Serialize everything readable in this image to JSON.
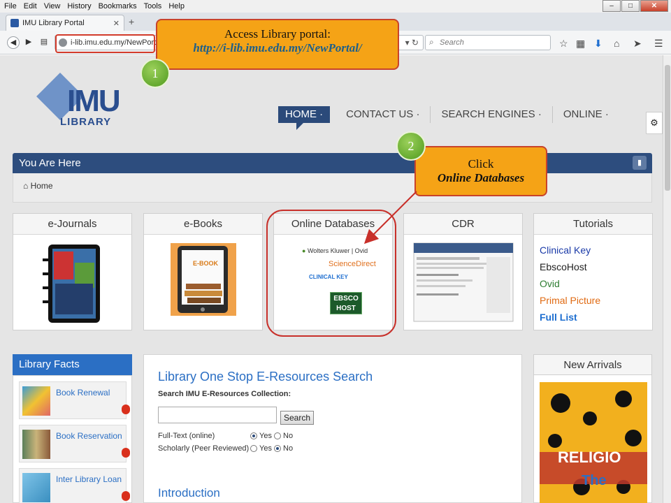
{
  "browser": {
    "menus": [
      "File",
      "Edit",
      "View",
      "History",
      "Bookmarks",
      "Tools",
      "Help"
    ],
    "tab_title": "IMU Library Portal",
    "url": "i-lib.imu.edu.my/NewPortal/",
    "search_placeholder": "Search",
    "window_controls": {
      "minimize": "–",
      "maximize": "□",
      "close": "✕"
    }
  },
  "header": {
    "logo_text": "IMU",
    "logo_subtext": "LIBRARY",
    "nav": [
      "HOME ·",
      "CONTACT US ·",
      "SEARCH ENGINES ·",
      "ONLINE ·"
    ]
  },
  "breadcrumb": {
    "heading": "You Are Here",
    "home": "Home"
  },
  "cards": [
    {
      "title": "e-Journals"
    },
    {
      "title": "e-Books",
      "cover_text": "E-BOOK"
    },
    {
      "title": "Online Databases",
      "logos": [
        "Wolters Kluwer",
        "Ovid",
        "ScienceDirect",
        "CLINICAL KEY",
        "EBSCO HOST"
      ]
    },
    {
      "title": "CDR"
    },
    {
      "title": "Tutorials"
    }
  ],
  "tutorials": {
    "links": [
      {
        "label": "Clinical Key",
        "color": "#1a3aa8"
      },
      {
        "label": "EbscoHost",
        "color": "#222222"
      },
      {
        "label": "Ovid",
        "color": "#2e7d32"
      },
      {
        "label": "Primal Picture",
        "color": "#e06a12"
      },
      {
        "label": "Full List",
        "color": "#1f6fd0"
      }
    ]
  },
  "library_facts": {
    "heading": "Library Facts",
    "items": [
      "Book Renewal",
      "Book Reservation",
      "Inter Library Loan"
    ]
  },
  "search": {
    "heading": "Library One Stop E-Resources Search",
    "subheading": "Search IMU E-Resources Collection:",
    "button": "Search",
    "fulltext_label": "Full-Text (online)",
    "scholarly_label": "Scholarly (Peer Reviewed)",
    "yes": "Yes",
    "no": "No",
    "fulltext_selected": "Yes",
    "scholarly_selected": "No",
    "intro_heading": "Introduction"
  },
  "new_arrivals": {
    "heading": "New Arrivals",
    "book_words": [
      "RELIGIO",
      "The"
    ]
  },
  "annotations": {
    "step1_number": "1",
    "step1_line1": "Access  Library portal:",
    "step1_line2": "http://i-lib.imu.edu.my/NewPortal/",
    "step2_number": "2",
    "step2_line1": "Click",
    "step2_line2": "Online Databases"
  },
  "colors": {
    "header_blue": "#2d4d7e",
    "link_blue": "#2b6fc4",
    "callout_orange": "#f5a316",
    "callout_border": "#c8432b",
    "badge_green": "#6ab232"
  }
}
